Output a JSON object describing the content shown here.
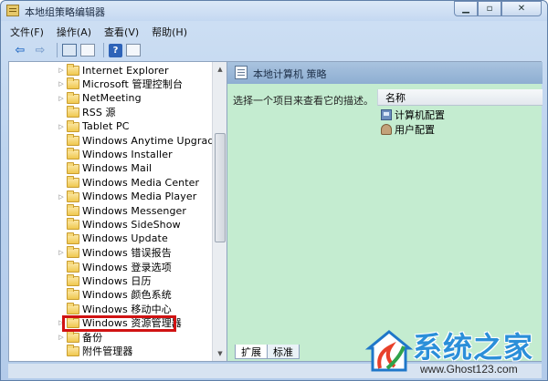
{
  "window": {
    "title": "本地组策略编辑器",
    "controls": [
      "minimize",
      "maximize",
      "close"
    ]
  },
  "menubar": {
    "items": [
      "文件(F)",
      "操作(A)",
      "查看(V)",
      "帮助(H)"
    ]
  },
  "toolbar": {
    "buttons": [
      "back-arrow-icon",
      "forward-arrow-icon",
      "show-hide-tree-icon",
      "export-list-icon",
      "properties-icon",
      "help-icon",
      "filter-icon"
    ]
  },
  "tree": {
    "items": [
      {
        "label": "Internet Explorer",
        "expandable": true
      },
      {
        "label": "Microsoft 管理控制台",
        "expandable": true
      },
      {
        "label": "NetMeeting",
        "expandable": true
      },
      {
        "label": "RSS 源",
        "expandable": false
      },
      {
        "label": "Tablet PC",
        "expandable": true
      },
      {
        "label": "Windows Anytime Upgrade",
        "expandable": false
      },
      {
        "label": "Windows Installer",
        "expandable": false
      },
      {
        "label": "Windows Mail",
        "expandable": false
      },
      {
        "label": "Windows Media Center",
        "expandable": false
      },
      {
        "label": "Windows Media Player",
        "expandable": true
      },
      {
        "label": "Windows Messenger",
        "expandable": false
      },
      {
        "label": "Windows SideShow",
        "expandable": false
      },
      {
        "label": "Windows Update",
        "expandable": false
      },
      {
        "label": "Windows 错误报告",
        "expandable": true
      },
      {
        "label": "Windows 登录选项",
        "expandable": false
      },
      {
        "label": "Windows 日历",
        "expandable": false
      },
      {
        "label": "Windows 颜色系统",
        "expandable": false
      },
      {
        "label": "Windows 移动中心",
        "expandable": false
      },
      {
        "label": "Windows 资源管理器",
        "expandable": true,
        "highlighted": true
      },
      {
        "label": "备份",
        "expandable": true
      },
      {
        "label": "附件管理器",
        "expandable": false
      }
    ]
  },
  "right": {
    "header": "本地计算机 策略",
    "description": "选择一个项目来查看它的描述。",
    "column_header": "名称",
    "items": [
      {
        "label": "计算机配置",
        "icon": "computer-icon"
      },
      {
        "label": "用户配置",
        "icon": "user-icon"
      }
    ],
    "tabs": [
      "扩展",
      "标准"
    ]
  },
  "watermark": {
    "title": "系统之家",
    "url": "www.Ghost123.com"
  },
  "colors": {
    "right_pane_bg": "#c4ecd0",
    "highlight_border": "#d01212",
    "title_bg": "#c4d8f1"
  }
}
